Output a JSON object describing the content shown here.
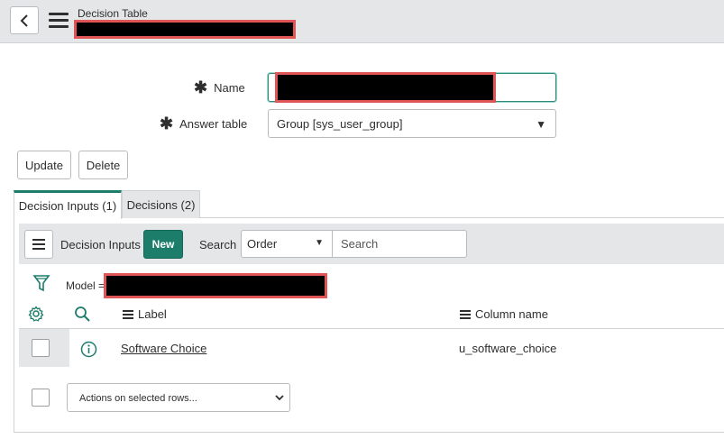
{
  "header": {
    "title": "Decision Table",
    "back_icon": "chevron-left-icon",
    "menu_icon": "hamburger-icon"
  },
  "form": {
    "name_label": "Name",
    "name_value": "",
    "answer_table_label": "Answer table",
    "answer_table_value": "Group [sys_user_group]",
    "required_marker": "✱"
  },
  "actions": {
    "update_label": "Update",
    "delete_label": "Delete"
  },
  "tabs": [
    {
      "label": "Decision Inputs (1)",
      "active": true
    },
    {
      "label": "Decisions (2)",
      "active": false
    }
  ],
  "list": {
    "title": "Decision Inputs",
    "new_label": "New",
    "search_label": "Search",
    "search_field": "Order",
    "search_placeholder": "Search",
    "filter_prefix": "Model =",
    "columns": [
      "Label",
      "Column name"
    ],
    "rows": [
      {
        "label": "Software Choice",
        "column_name": "u_software_choice"
      }
    ],
    "actions_placeholder": "Actions on selected rows..."
  },
  "colors": {
    "accent": "#1c7d6b",
    "header_bg": "#e4e6e7",
    "redaction_border": "#e05555"
  }
}
